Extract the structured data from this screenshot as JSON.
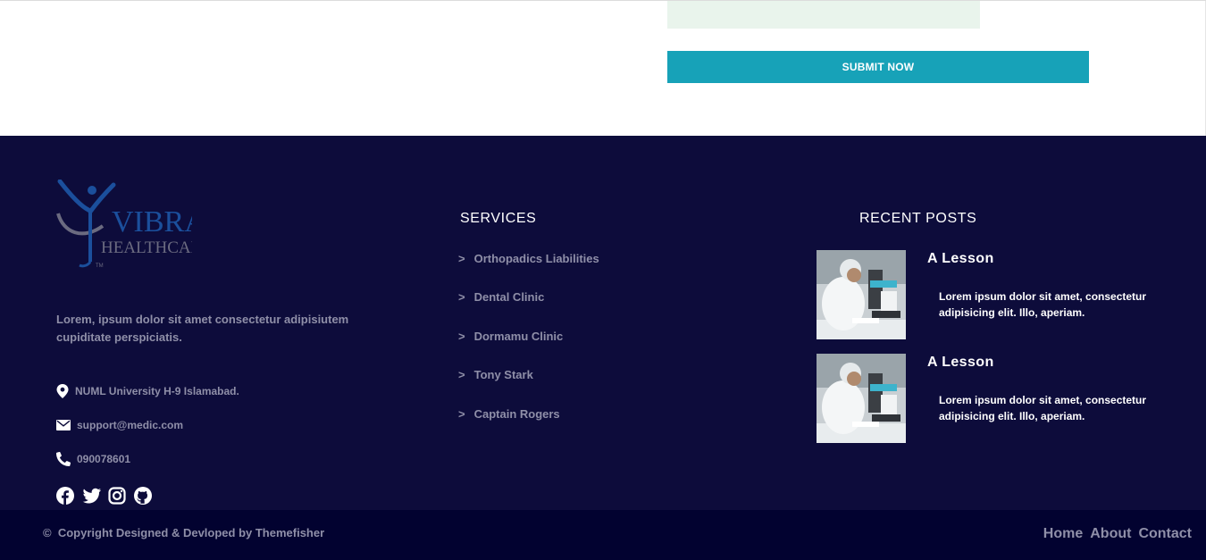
{
  "form": {
    "submit_label": "SUBMIT NOW"
  },
  "footer": {
    "logo": {
      "line1": "VIBRA",
      "line2": "HEALTHCARE",
      "mark": "TM"
    },
    "about": "Lorem, ipsum dolor sit amet consectetur adipisiutem cupiditate perspiciatis.",
    "contacts": {
      "address": "NUML University H-9 Islamabad.",
      "email": "support@medic.com",
      "phone": "090078601"
    },
    "social_icons": [
      "facebook-icon",
      "twitter-icon",
      "instagram-icon",
      "github-icon"
    ],
    "services": {
      "title": "SERVICES",
      "chevron": ">",
      "items": [
        "Orthopadics Liabilities",
        "Dental Clinic",
        "Dormamu Clinic",
        "Tony Stark",
        "Captain Rogers"
      ]
    },
    "recent_posts": {
      "title": "RECENT POSTS",
      "posts": [
        {
          "title": "A Lesson",
          "excerpt": "Lorem ipsum dolor sit amet, consectetur adipisicing elit. Illo, aperiam."
        },
        {
          "title": "A Lesson",
          "excerpt": "Lorem ipsum dolor sit amet, consectetur adipisicing elit. Illo, aperiam."
        }
      ]
    }
  },
  "bottom_bar": {
    "copyright_symbol": "©",
    "copyright": "Copyright Designed & Devloped by Themefisher",
    "nav": [
      "Home",
      "About",
      "Contact"
    ]
  },
  "colors": {
    "accent": "#17a2b8",
    "footer_bg": "#0d0c3b",
    "bottom_bg": "#020230",
    "muted_text": "#8f8fa8",
    "logo_blue": "#1b4f9c"
  }
}
